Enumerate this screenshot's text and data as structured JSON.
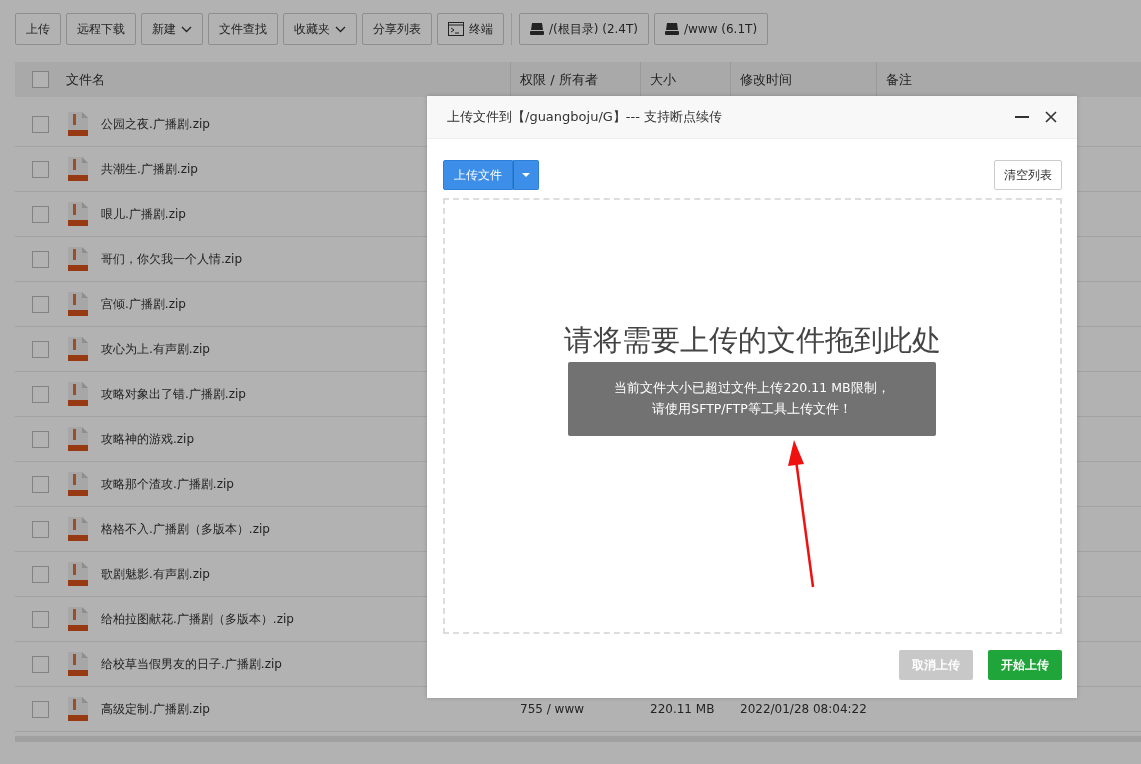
{
  "toolbar": [
    {
      "label": "上传",
      "kind": "plain"
    },
    {
      "label": "远程下载",
      "kind": "plain"
    },
    {
      "label": "新建",
      "kind": "dropdown"
    },
    {
      "label": "文件查找",
      "kind": "plain"
    },
    {
      "label": "收藏夹",
      "kind": "dropdown"
    },
    {
      "label": "分享列表",
      "kind": "plain"
    },
    {
      "label": "终端",
      "kind": "terminal"
    },
    {
      "label": "/(根目录) (2.4T)",
      "kind": "disk"
    },
    {
      "label": "/www (6.1T)",
      "kind": "disk"
    }
  ],
  "table": {
    "header_checked": false,
    "columns": [
      "文件名",
      "权限 / 所有者",
      "大小",
      "修改时间",
      "备注"
    ],
    "rows": [
      {
        "name": "公园之夜.广播剧.zip",
        "checked": false
      },
      {
        "name": "共潮生.广播剧.zip",
        "checked": false
      },
      {
        "name": "哏儿.广播剧.zip",
        "checked": false
      },
      {
        "name": "哥们，你欠我一个人情.zip",
        "checked": false
      },
      {
        "name": "宫倾.广播剧.zip",
        "checked": false
      },
      {
        "name": "攻心为上.有声剧.zip",
        "checked": false
      },
      {
        "name": "攻略对象出了错.广播剧.zip",
        "checked": false
      },
      {
        "name": "攻略神的游戏.zip",
        "checked": false
      },
      {
        "name": "攻略那个渣攻.广播剧.zip",
        "checked": false
      },
      {
        "name": "格格不入.广播剧（多版本）.zip",
        "checked": false
      },
      {
        "name": "歌剧魅影.有声剧.zip",
        "checked": false
      },
      {
        "name": "给柏拉图献花.广播剧（多版本）.zip",
        "checked": false
      },
      {
        "name": "给校草当假男友的日子.广播剧.zip",
        "checked": false
      },
      {
        "name": "高级定制.广播剧.zip",
        "checked": false,
        "permission": "755 / www",
        "size": "220.11 MB",
        "modified": "2022/01/28 08:04:22"
      }
    ]
  },
  "dialog": {
    "title": "上传文件到【/guangboju/G】--- 支持断点续传",
    "upload_button": "上传文件",
    "clear_button": "清空列表",
    "dropzone_text": "请将需要上传的文件拖到此处",
    "toast": [
      "当前文件大小已超过文件上传220.11 MB限制，",
      "请使用SFTP/FTP等工具上传文件！"
    ],
    "buttons": [
      {
        "label": "取消上传",
        "kind": "cancel",
        "disabled": true
      },
      {
        "label": "开始上传",
        "kind": "start",
        "disabled": false
      }
    ]
  }
}
